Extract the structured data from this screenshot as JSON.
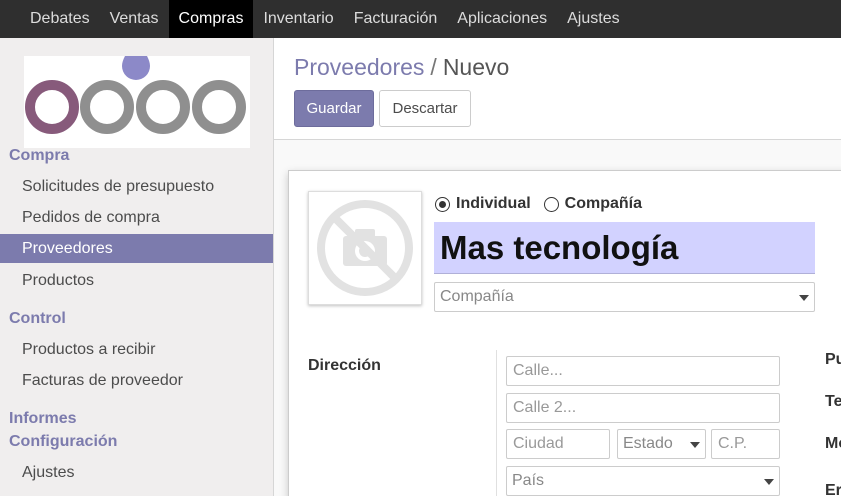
{
  "top_menu": [
    "Debates",
    "Ventas",
    "Compras",
    "Inventario",
    "Facturación",
    "Aplicaciones",
    "Ajustes"
  ],
  "top_menu_active": "Compras",
  "sidebar": {
    "section_compra": "Compra",
    "items_compra": [
      "Solicitudes de presupuesto",
      "Pedidos de compra",
      "Proveedores",
      "Productos"
    ],
    "section_control": "Control",
    "items_control": [
      "Productos a recibir",
      "Facturas de proveedor"
    ],
    "section_informes": "Informes",
    "section_config": "Configuración",
    "items_config": [
      "Ajustes"
    ],
    "active_item": "Proveedores"
  },
  "breadcrumb": {
    "parent": "Proveedores",
    "separator": "/",
    "current": "Nuevo"
  },
  "buttons": {
    "save": "Guardar",
    "discard": "Descartar"
  },
  "form": {
    "type_options": [
      "Individual",
      "Compañía"
    ],
    "type_selected": "Individual",
    "name": "Mas tecnología",
    "company_placeholder": "Compañía",
    "address_label": "Dirección",
    "street_placeholder": "Calle...",
    "street2_placeholder": "Calle 2...",
    "city_placeholder": "Ciudad",
    "state_placeholder": "Estado",
    "zip_placeholder": "C.P.",
    "country_placeholder": "País",
    "right_labels_partial": [
      "Pu",
      "Te",
      "Mo",
      "Er"
    ]
  },
  "colors": {
    "brand": "#7c7bad",
    "topbar": "#2f2f2f",
    "sidebar_bg": "#f0eeee",
    "name_field_bg": "#d2d2ff"
  }
}
